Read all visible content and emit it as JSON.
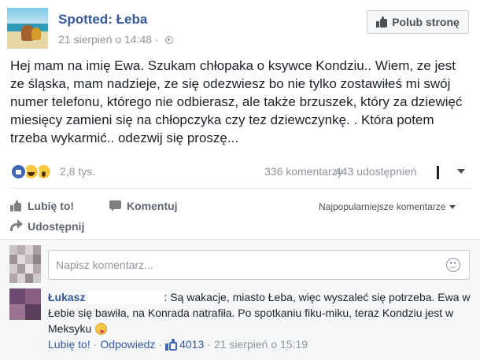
{
  "page": {
    "name": "Spotted: Łeba",
    "date": "21 sierpień o 14:48 · ",
    "like_button": "Polub stronę"
  },
  "post": {
    "text": "Hej mam na imię Ewa. Szukam chłopaka o ksywce Kondziu.. Wiem, ze jest ze śląska, mam nadzieje, ze się odezwiesz bo nie tylko zostawiłeś mi swój numer telefonu, którego nie odbierasz, ale także brzuszek, który za dziewięć miesięcy zamieni się na chłopczyka czy tez dziewczynkę. . Która potem trzeba wykarmić.. odezwij się proszę..."
  },
  "stats": {
    "reactions": "2,8 tys.",
    "comments": "336 komentarzy",
    "shares": "443 udostępnień"
  },
  "actions": {
    "like": "Lubię to!",
    "comment": "Komentuj",
    "share": "Udostępnij",
    "sort": "Najpopularniejsze komentarze"
  },
  "comment_box": {
    "placeholder": "Napisz komentarz..."
  },
  "comment": {
    "author": "Łukasz",
    "text": ": Są wakacje, miasto Łeba, więc wyszaleć się potrzeba. Ewa w Łebie się bawiła, na Konrada natrafiła. Po spotkaniu fiku-miku, teraz Kondziu jest w Meksyku",
    "like_link": "Lubię to!",
    "reply_link": "Odpowiedz",
    "likes": "4013",
    "date": "21 sierpień o 15:19"
  },
  "colors": {
    "link": "#365899",
    "meta": "#90949c",
    "like_blue": "#4267b2"
  }
}
